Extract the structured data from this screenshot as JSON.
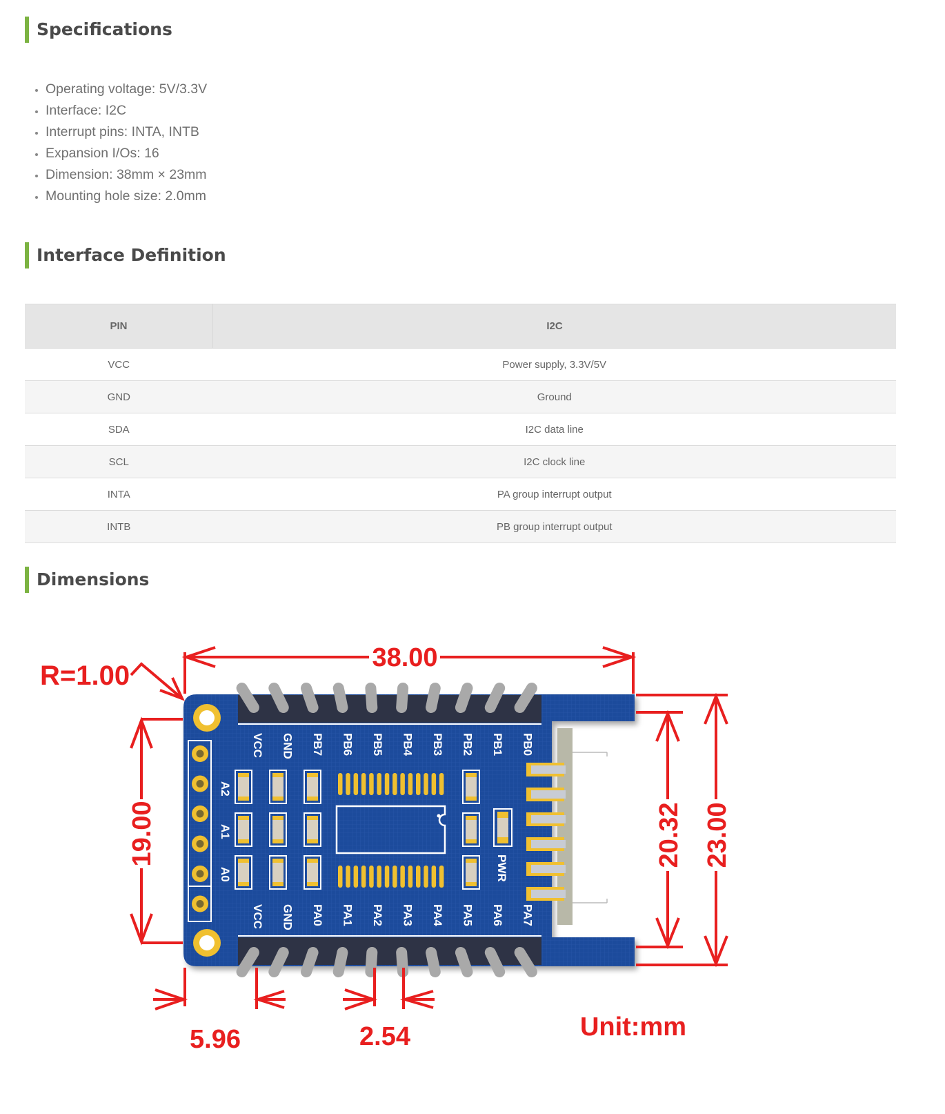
{
  "sections": {
    "specifications": {
      "title": "Specifications",
      "items": [
        "Operating voltage: 5V/3.3V",
        "Interface: I2C",
        "Interrupt pins: INTA, INTB",
        "Expansion I/Os: 16",
        "Dimension: 38mm × 23mm",
        "Mounting hole size: 2.0mm"
      ]
    },
    "interface": {
      "title": "Interface Definition",
      "headers": [
        "PIN",
        "I2C"
      ],
      "rows": [
        [
          "VCC",
          "Power supply, 3.3V/5V"
        ],
        [
          "GND",
          "Ground"
        ],
        [
          "SDA",
          "I2C data line"
        ],
        [
          "SCL",
          "I2C clock line"
        ],
        [
          "INTA",
          "PA group interrupt output"
        ],
        [
          "INTB",
          "PB group interrupt output"
        ]
      ]
    },
    "dimensions": {
      "title": "Dimensions",
      "labels": {
        "width": "38.00",
        "radius": "R=1.00",
        "hole_spacing": "19.00",
        "connector_height": "20.32",
        "height": "23.00",
        "edge_offset": "5.96",
        "pitch": "2.54",
        "unit": "Unit:mm"
      },
      "silkscreen": {
        "top_pins": [
          "VCC",
          "GND",
          "PB7",
          "PB6",
          "PB5",
          "PB4",
          "PB3",
          "PB2",
          "PB1",
          "PB0"
        ],
        "bottom_pins": [
          "VCC",
          "GND",
          "PA0",
          "PA1",
          "PA2",
          "PA3",
          "PA4",
          "PA5",
          "PA6",
          "PA7"
        ],
        "address": [
          "A2",
          "A1",
          "A0"
        ],
        "pwr": "PWR"
      },
      "colors": {
        "pcb": "#1e4a9a",
        "annotation": "#e81f1f",
        "pad": "#f0c030",
        "accent": "#7cb342"
      }
    }
  }
}
